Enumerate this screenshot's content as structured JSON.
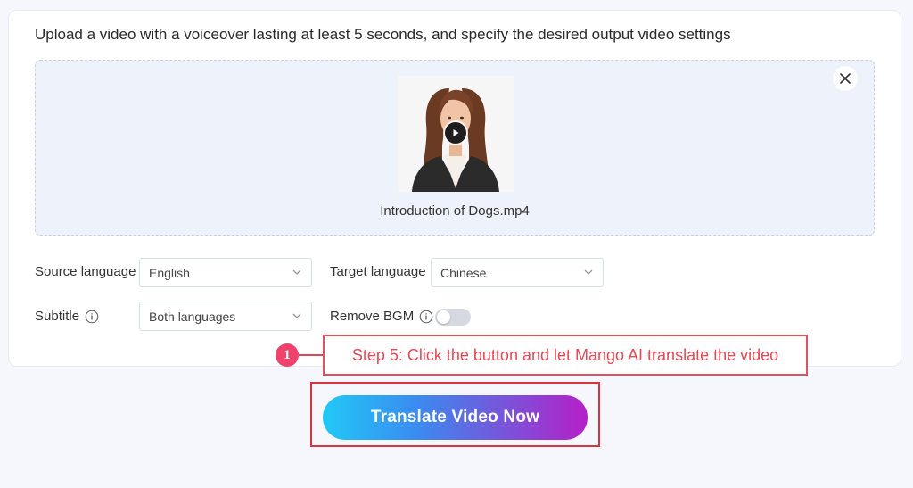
{
  "instruction": "Upload a video with a voiceover lasting at least 5 seconds, and specify the desired output video settings",
  "upload": {
    "filename": "Introduction of Dogs.mp4",
    "close_icon": "close-icon",
    "play_icon": "play-icon"
  },
  "settings": {
    "source_language_label": "Source language",
    "source_language_value": "English",
    "target_language_label": "Target language",
    "target_language_value": "Chinese",
    "subtitle_label": "Subtitle",
    "subtitle_value": "Both languages",
    "remove_bgm_label": "Remove BGM",
    "remove_bgm_enabled": false
  },
  "callout": {
    "step_number": "1",
    "text": "Step 5: Click the button and let Mango AI translate the video",
    "color": "#e24a56"
  },
  "action": {
    "translate_label": "Translate Video Now"
  },
  "colors": {
    "gradient_start": "#21c9f6",
    "gradient_end": "#b61fc8",
    "highlight_border": "#d9343f",
    "dropzone_bg": "#eef2fb"
  }
}
